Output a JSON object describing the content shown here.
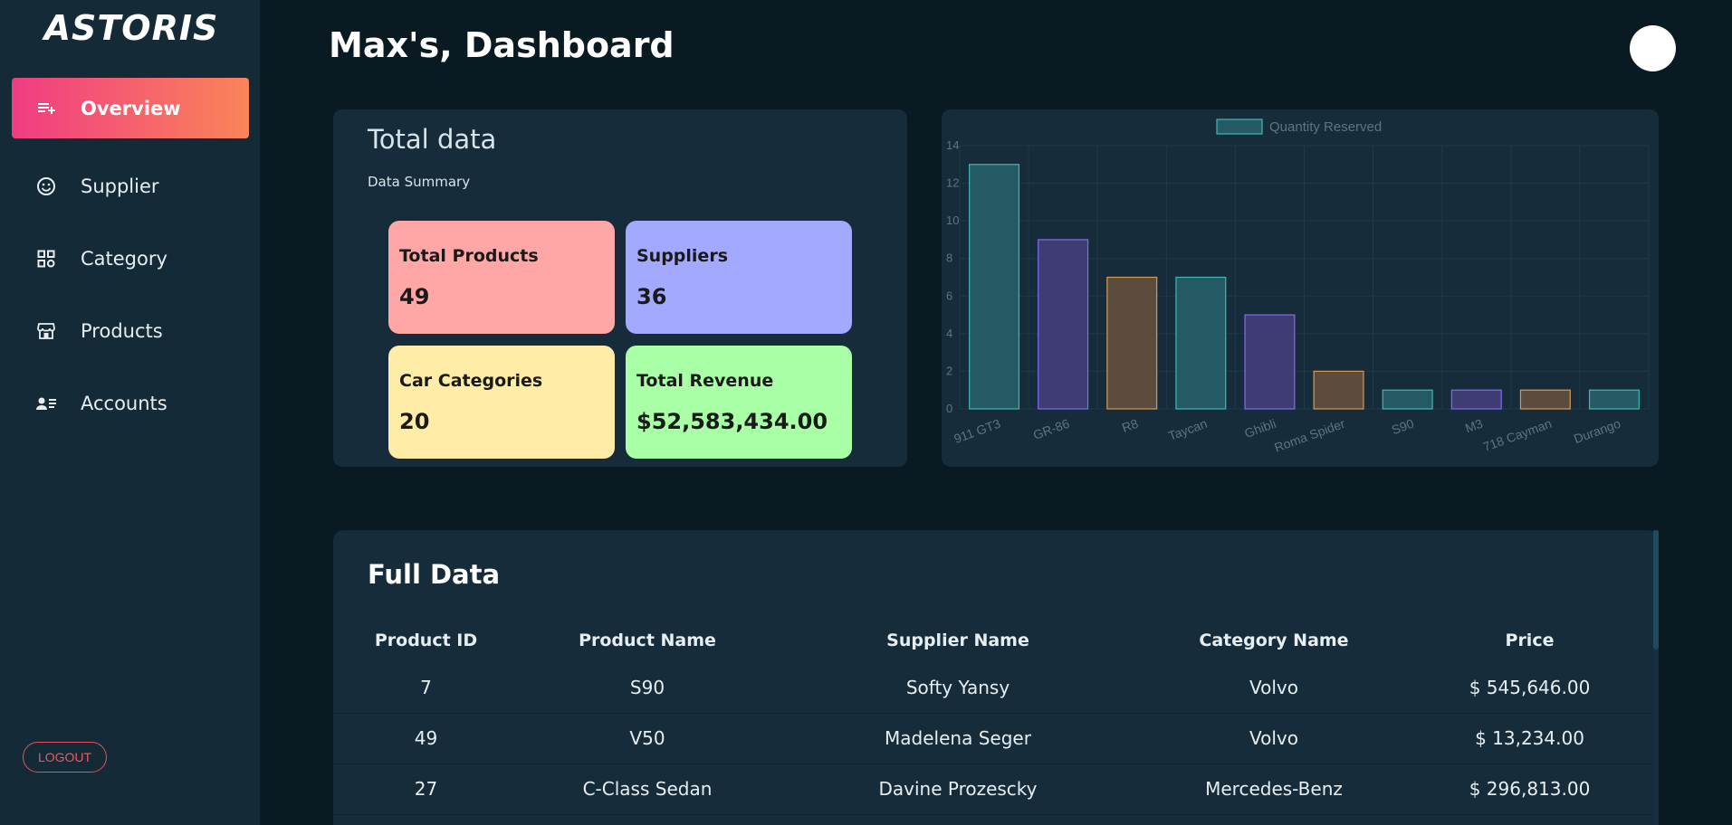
{
  "sidebar": {
    "logo": "ASTORIS",
    "items": [
      {
        "label": "Overview",
        "icon": "playlist-add-icon",
        "active": true
      },
      {
        "label": "Supplier",
        "icon": "smiley-icon"
      },
      {
        "label": "Category",
        "icon": "grid-icon"
      },
      {
        "label": "Products",
        "icon": "store-icon"
      },
      {
        "label": "Accounts",
        "icon": "contact-list-icon"
      }
    ],
    "logout": "LOGOUT"
  },
  "header": {
    "title": "Max's, Dashboard"
  },
  "summary": {
    "title": "Total data",
    "subtitle": "Data Summary",
    "stats": [
      {
        "label": "Total Products",
        "value": "49",
        "color": "#ffa6a6"
      },
      {
        "label": "Suppliers",
        "value": "36",
        "color": "#a2a9ff"
      },
      {
        "label": "Car Categories",
        "value": "20",
        "color": "#ffeca6"
      },
      {
        "label": "Total Revenue",
        "value": "$52,583,434.00",
        "color": "#a8ffa6"
      }
    ]
  },
  "chart_data": {
    "type": "bar",
    "categories": [
      "911 GT3",
      "GR-86",
      "R8",
      "Taycan",
      "Ghibli",
      "Roma Spider",
      "S90",
      "M3",
      "718 Cayman",
      "Durango"
    ],
    "series": [
      {
        "name": "Quantity Reserved",
        "values": [
          13,
          9,
          7,
          7,
          5,
          2,
          1,
          1,
          1,
          1
        ]
      }
    ],
    "bar_colors": [
      "teal",
      "purple",
      "brown",
      "teal",
      "purple",
      "brown",
      "teal",
      "purple",
      "brown",
      "teal"
    ],
    "ylim": [
      0,
      14
    ],
    "yticks": [
      0,
      2,
      4,
      6,
      8,
      10,
      12,
      14
    ],
    "grid": true,
    "legend": "top-center"
  },
  "full_data": {
    "title": "Full Data",
    "columns": [
      "Product ID",
      "Product Name",
      "Supplier Name",
      "Category Name",
      "Price"
    ],
    "rows": [
      [
        "7",
        "S90",
        "Softy Yansy",
        "Volvo",
        "$ 545,646.00"
      ],
      [
        "49",
        "V50",
        "Madelena Seger",
        "Volvo",
        "$ 13,234.00"
      ],
      [
        "27",
        "C-Class Sedan",
        "Davine Prozescky",
        "Mercedes-Benz",
        "$ 296,813.00"
      ]
    ]
  }
}
